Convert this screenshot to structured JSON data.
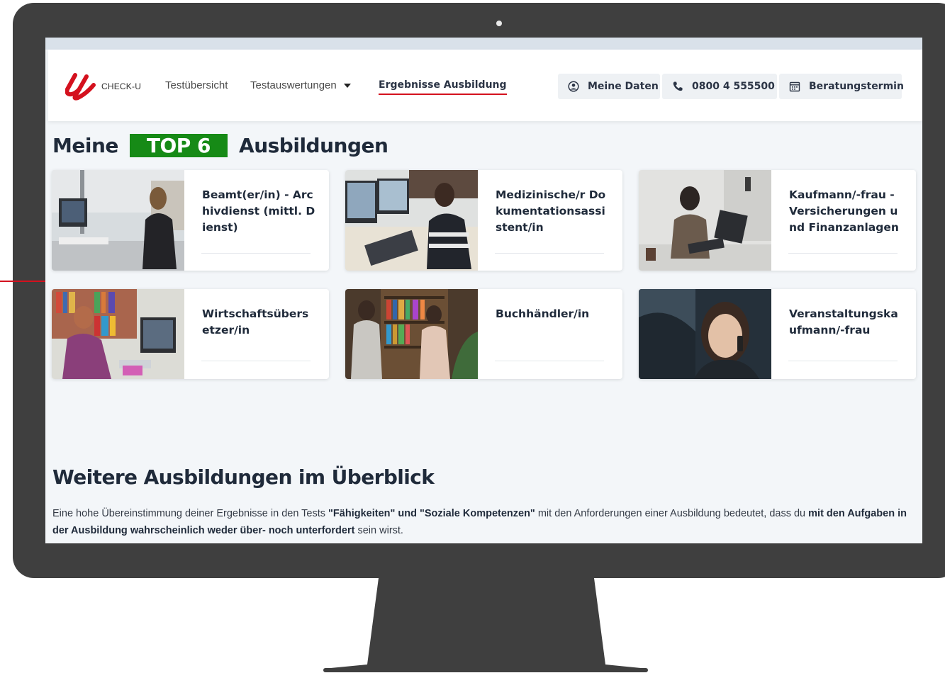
{
  "brand": {
    "logo_text": "CHECK-U"
  },
  "nav": {
    "links": [
      {
        "label": "Testübersicht"
      },
      {
        "label": "Testauswertungen"
      },
      {
        "label": "Ergebnisse Ausbildung"
      }
    ],
    "buttons": {
      "profile": "Meine Daten",
      "phone": "0800 4 555500",
      "appointment": "Beratungstermin"
    }
  },
  "top": {
    "prefix": "Meine",
    "badge": "TOP 6",
    "suffix": "Ausbildungen"
  },
  "cards": [
    {
      "title": "Beamt(er/in) - Archivdienst (mittl. Dienst)"
    },
    {
      "title": "Medizinische/r Dokumentationsassistent/in"
    },
    {
      "title": "Kaufmann/-frau - Versicherungen und Finanzanlagen"
    },
    {
      "title": "Wirtschaftsübersetzer/in"
    },
    {
      "title": "Buchhändler/in"
    },
    {
      "title": "Veranstaltungskaufmann/-frau"
    }
  ],
  "more": {
    "heading": "Weitere Ausbildungen im Überblick",
    "p1": "Eine hohe Übereinstimmung deiner Ergebnisse in den Tests ",
    "b1": "\"Fähigkeiten\" und \"Soziale Kompetenzen\"",
    "p2": " mit den Anforderungen einer Ausbildung bedeutet, dass du ",
    "b2": "mit den Aufgaben in der Ausbildung wahrscheinlich weder über- noch unterfordert",
    "p3": " sein wirst."
  },
  "colors": {
    "accent": "#d4111e",
    "badge": "#168a16",
    "frame": "#3f3f3f"
  }
}
